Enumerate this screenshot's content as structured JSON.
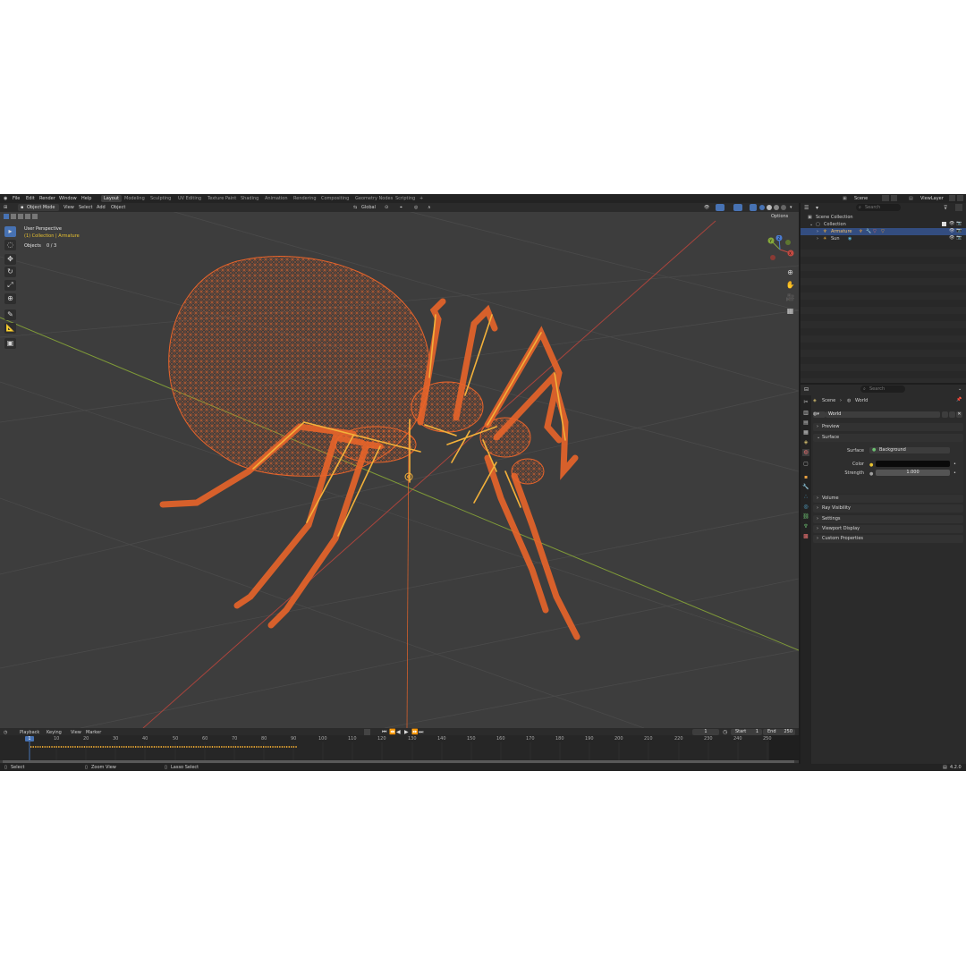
{
  "menu": [
    "File",
    "Edit",
    "Render",
    "Window",
    "Help"
  ],
  "workspaces": [
    "Layout",
    "Modeling",
    "Sculpting",
    "UV Editing",
    "Texture Paint",
    "Shading",
    "Animation",
    "Rendering",
    "Compositing",
    "Geometry Nodes",
    "Scripting",
    "+"
  ],
  "scene_name": "Scene",
  "view_layer": "ViewLayer",
  "viewport_header": {
    "mode": "Object Mode",
    "items": [
      "View",
      "Select",
      "Add",
      "Object"
    ],
    "transform_orientation": "Global",
    "options": "Options"
  },
  "viewport_overlay": {
    "view_name": "User Perspective",
    "collection_path": "(1) Collection | Armature",
    "objects_label": "Objects",
    "objects_count": "0 / 3"
  },
  "gizmo": {
    "x": "X",
    "y": "Y",
    "z": "Z"
  },
  "outliner": {
    "search_placeholder": "Search",
    "root": "Scene Collection",
    "collection": "Collection",
    "items": [
      "Armature",
      "Sun"
    ]
  },
  "properties": {
    "search_placeholder": "Search",
    "breadcrumb_scene": "Scene",
    "breadcrumb_world": "World",
    "world_name": "World",
    "panels": {
      "preview": "Preview",
      "surface": "Surface",
      "volume": "Volume",
      "ray_visibility": "Ray Visibility",
      "settings": "Settings",
      "viewport_display": "Viewport Display",
      "custom_properties": "Custom Properties"
    },
    "surface_label": "Surface",
    "surface_value": "Background",
    "color_label": "Color",
    "strength_label": "Strength",
    "strength_value": "1.000"
  },
  "timeline": {
    "menus": [
      "Playback",
      "Keying",
      "View",
      "Marker"
    ],
    "current_frame": "1",
    "start_label": "Start",
    "start_value": "1",
    "end_label": "End",
    "end_value": "250",
    "ruler": [
      "1",
      "10",
      "20",
      "30",
      "40",
      "50",
      "60",
      "70",
      "80",
      "90",
      "100",
      "110",
      "120",
      "130",
      "140",
      "150",
      "160",
      "170",
      "180",
      "190",
      "200",
      "210",
      "220",
      "230",
      "240",
      "250"
    ]
  },
  "statusbar": {
    "select": "Select",
    "zoom": "Zoom View",
    "lasso": "Lasso Select",
    "version": "4.2.0"
  },
  "colors": {
    "accent": "#4772b3",
    "wire": "#e8642a",
    "bone": "#f3b13a",
    "x_axis": "#c34a42",
    "y_axis": "#86a83a"
  }
}
